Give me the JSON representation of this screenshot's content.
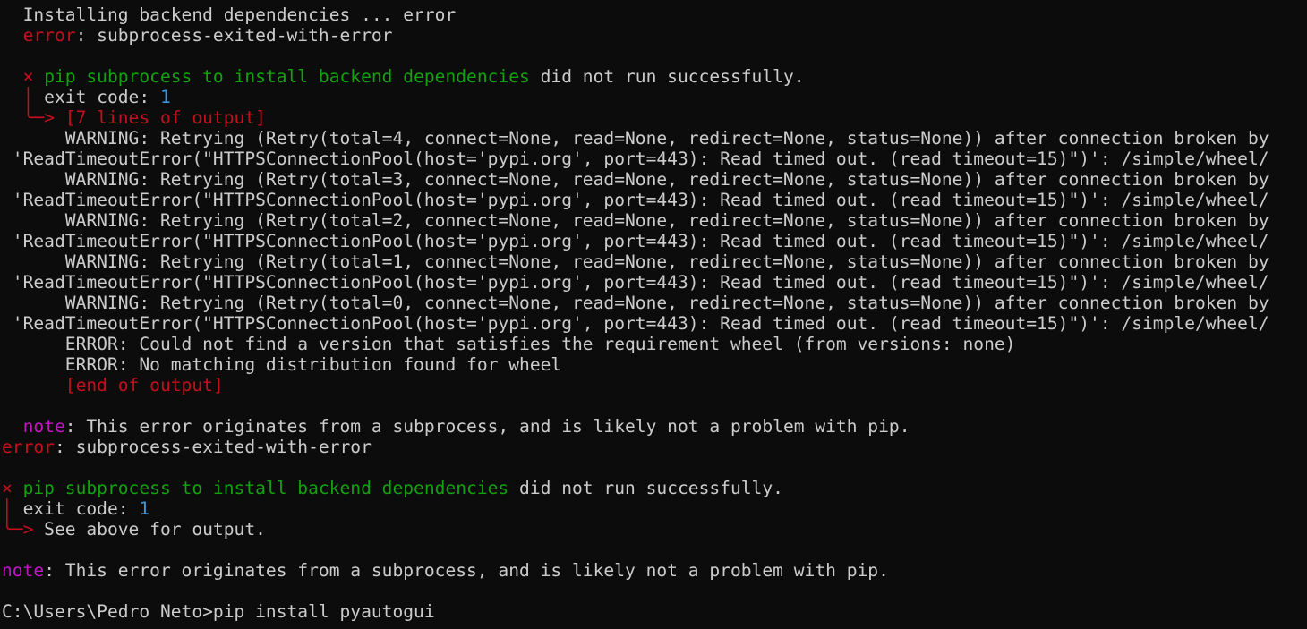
{
  "terminal": {
    "lines": [
      [
        {
          "text": "  Installing backend dependencies ... error",
          "color": "white"
        }
      ],
      [
        {
          "text": "  ",
          "color": "white"
        },
        {
          "text": "error",
          "color": "red"
        },
        {
          "text": ": subprocess-exited-with-error",
          "color": "white"
        }
      ],
      [
        {
          "text": "",
          "color": "white"
        }
      ],
      [
        {
          "text": "  ",
          "color": "white"
        },
        {
          "text": "×",
          "color": "red"
        },
        {
          "text": " ",
          "color": "white"
        },
        {
          "text": "pip subprocess to install backend dependencies",
          "color": "green"
        },
        {
          "text": " did not run successfully.",
          "color": "white"
        }
      ],
      [
        {
          "text": "  ",
          "color": "white"
        },
        {
          "text": "│",
          "color": "red"
        },
        {
          "text": " exit code: ",
          "color": "white"
        },
        {
          "text": "1",
          "color": "cyan"
        }
      ],
      [
        {
          "text": "  ",
          "color": "white"
        },
        {
          "text": "╰─> [7 lines of output]",
          "color": "red"
        }
      ],
      [
        {
          "text": "      WARNING: Retrying (Retry(total=4, connect=None, read=None, redirect=None, status=None)) after connection broken by",
          "color": "white"
        }
      ],
      [
        {
          "text": " 'ReadTimeoutError(\"HTTPSConnectionPool(host='pypi.org', port=443): Read timed out. (read timeout=15)\")': /simple/wheel/",
          "color": "white"
        }
      ],
      [
        {
          "text": "      WARNING: Retrying (Retry(total=3, connect=None, read=None, redirect=None, status=None)) after connection broken by",
          "color": "white"
        }
      ],
      [
        {
          "text": " 'ReadTimeoutError(\"HTTPSConnectionPool(host='pypi.org', port=443): Read timed out. (read timeout=15)\")': /simple/wheel/",
          "color": "white"
        }
      ],
      [
        {
          "text": "      WARNING: Retrying (Retry(total=2, connect=None, read=None, redirect=None, status=None)) after connection broken by",
          "color": "white"
        }
      ],
      [
        {
          "text": " 'ReadTimeoutError(\"HTTPSConnectionPool(host='pypi.org', port=443): Read timed out. (read timeout=15)\")': /simple/wheel/",
          "color": "white"
        }
      ],
      [
        {
          "text": "      WARNING: Retrying (Retry(total=1, connect=None, read=None, redirect=None, status=None)) after connection broken by",
          "color": "white"
        }
      ],
      [
        {
          "text": " 'ReadTimeoutError(\"HTTPSConnectionPool(host='pypi.org', port=443): Read timed out. (read timeout=15)\")': /simple/wheel/",
          "color": "white"
        }
      ],
      [
        {
          "text": "      WARNING: Retrying (Retry(total=0, connect=None, read=None, redirect=None, status=None)) after connection broken by",
          "color": "white"
        }
      ],
      [
        {
          "text": " 'ReadTimeoutError(\"HTTPSConnectionPool(host='pypi.org', port=443): Read timed out. (read timeout=15)\")': /simple/wheel/",
          "color": "white"
        }
      ],
      [
        {
          "text": "      ERROR: Could not find a version that satisfies the requirement wheel (from versions: none)",
          "color": "white"
        }
      ],
      [
        {
          "text": "      ERROR: No matching distribution found for wheel",
          "color": "white"
        }
      ],
      [
        {
          "text": "      ",
          "color": "white"
        },
        {
          "text": "[end of output]",
          "color": "red"
        }
      ],
      [
        {
          "text": "",
          "color": "white"
        }
      ],
      [
        {
          "text": "  ",
          "color": "white"
        },
        {
          "text": "note",
          "color": "magenta"
        },
        {
          "text": ": This error originates from a subprocess, and is likely not a problem with pip.",
          "color": "white"
        }
      ],
      [
        {
          "text": "error",
          "color": "red"
        },
        {
          "text": ": subprocess-exited-with-error",
          "color": "white"
        }
      ],
      [
        {
          "text": "",
          "color": "white"
        }
      ],
      [
        {
          "text": "×",
          "color": "red"
        },
        {
          "text": " ",
          "color": "white"
        },
        {
          "text": "pip subprocess to install backend dependencies",
          "color": "green"
        },
        {
          "text": " did not run successfully.",
          "color": "white"
        }
      ],
      [
        {
          "text": "│",
          "color": "red"
        },
        {
          "text": " exit code: ",
          "color": "white"
        },
        {
          "text": "1",
          "color": "cyan"
        }
      ],
      [
        {
          "text": "╰─>",
          "color": "red"
        },
        {
          "text": " See above for output.",
          "color": "white"
        }
      ],
      [
        {
          "text": "",
          "color": "white"
        }
      ],
      [
        {
          "text": "note",
          "color": "magenta"
        },
        {
          "text": ": This error originates from a subprocess, and is likely not a problem with pip.",
          "color": "white"
        }
      ],
      [
        {
          "text": "",
          "color": "white"
        }
      ],
      [
        {
          "text": "C:\\Users\\Pedro Neto>pip install pyautogui",
          "color": "white"
        }
      ]
    ]
  },
  "colors": {
    "background": "#0c0c0c",
    "foreground": "#cccccc",
    "red": "#c50f1f",
    "green": "#13a10e",
    "cyan": "#3a96dd",
    "magenta": "#c116c1"
  }
}
